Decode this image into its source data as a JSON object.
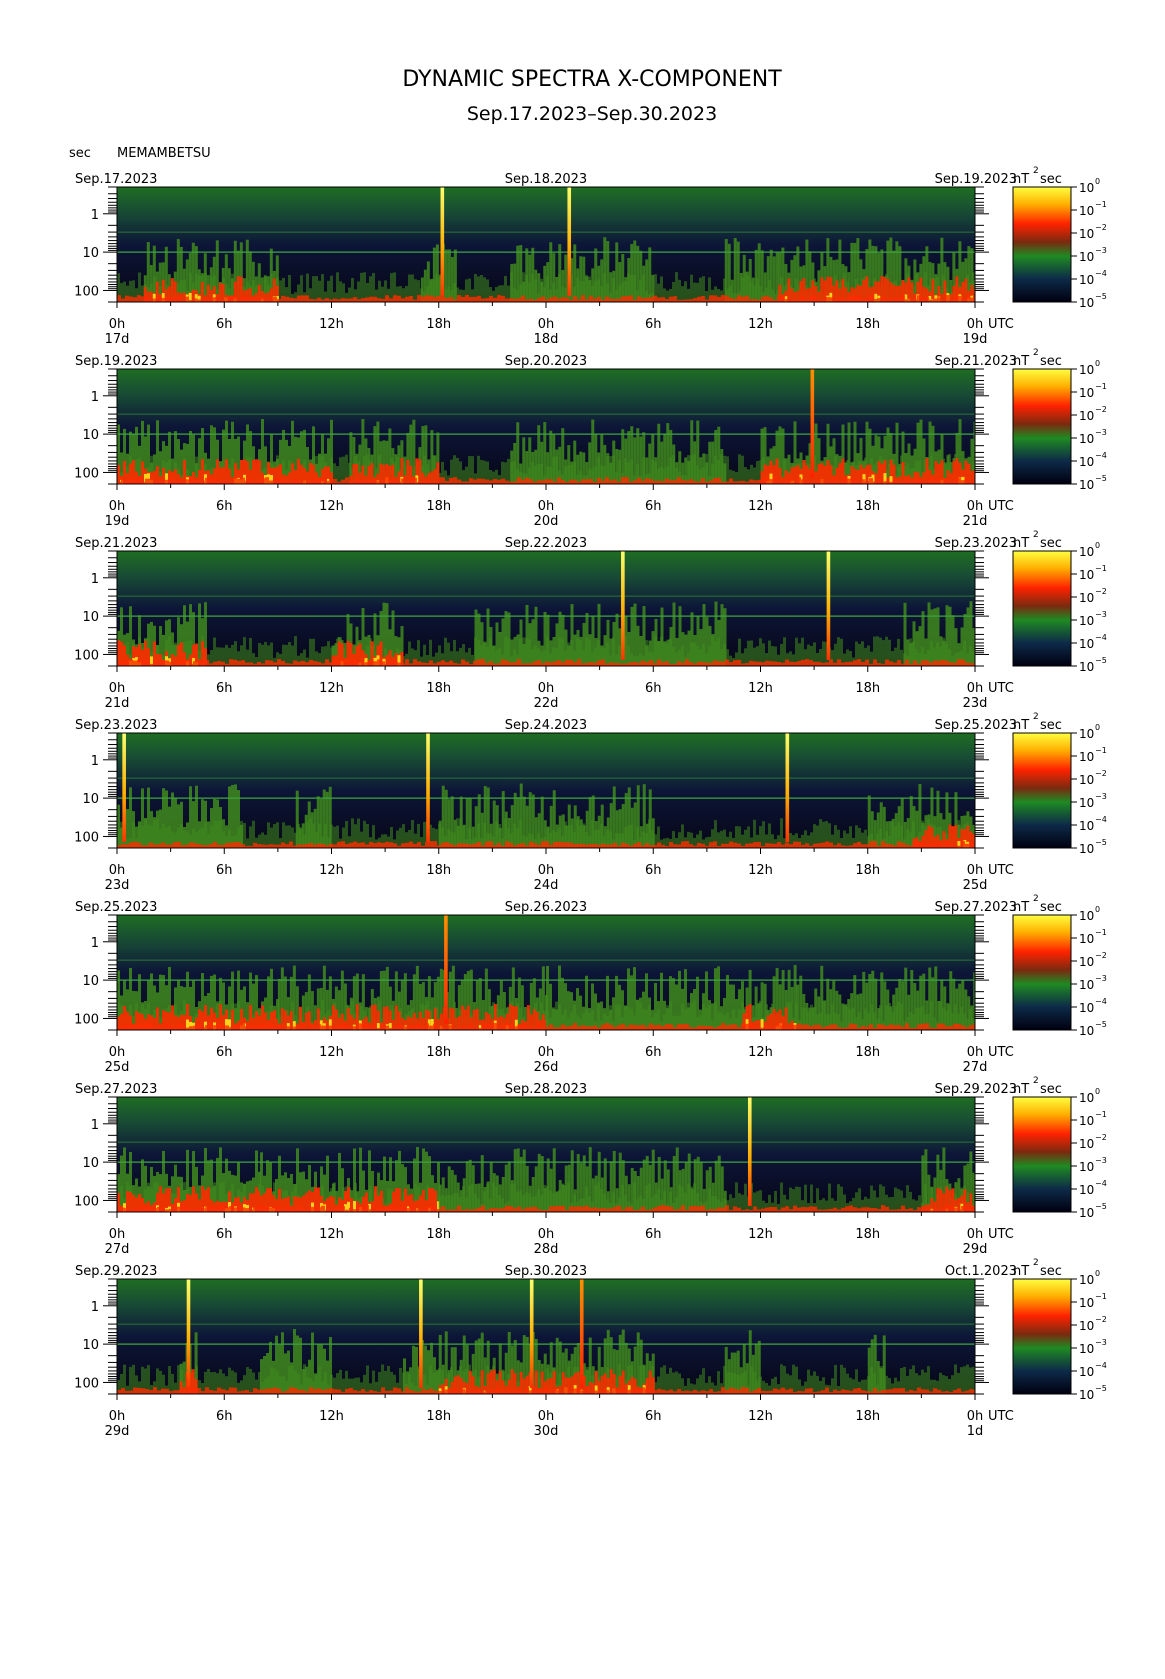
{
  "title": "DYNAMIC SPECTRA X-COMPONENT",
  "subtitle": "Sep.17.2023–Sep.30.2023",
  "station_units_label": "sec",
  "station": "MEMAMBETSU",
  "y_ticks": [
    "1",
    "10",
    "100"
  ],
  "time_axis_label": "UTC",
  "colorbar_unit": "nT²sec",
  "colorbar_unit_nT": "nT",
  "colorbar_unit_exp": "2",
  "colorbar_unit_sec": "sec",
  "colorbar_ticks": [
    {
      "base": "10",
      "exp": "0"
    },
    {
      "base": "10",
      "exp": "−1"
    },
    {
      "base": "10",
      "exp": "−2"
    },
    {
      "base": "10",
      "exp": "−3"
    },
    {
      "base": "10",
      "exp": "−4"
    },
    {
      "base": "10",
      "exp": "−5"
    }
  ],
  "colors": {
    "background_high": "#1e6a1e",
    "background_low": "#0a0a26",
    "activity": "#3f8a1d",
    "hot": "#ff2a00",
    "peak": "#ffd21a"
  },
  "chart_data": [
    {
      "type": "heatmap",
      "start_label": "Sep.17.2023",
      "mid_label": "Sep.18.2023",
      "end_label": "Sep.19.2023",
      "hour_ticks": [
        "0h",
        "6h",
        "12h",
        "18h",
        "0h",
        "6h",
        "12h",
        "18h",
        "0h"
      ],
      "day_ticks": [
        "17d",
        "18d",
        "19d"
      ],
      "ylabel": "sec",
      "ylim": [
        0.2,
        200
      ],
      "y_scale": "log",
      "colorbar_range": [
        1e-05,
        1
      ],
      "spikes": [
        {
          "time_h": 18.2,
          "intensity": "peak"
        },
        {
          "time_h": 25.3,
          "intensity": "peak"
        }
      ],
      "activity_bursts": [
        {
          "start_h": 1.5,
          "end_h": 9,
          "level": "hot"
        },
        {
          "start_h": 17,
          "end_h": 19,
          "level": "active"
        },
        {
          "start_h": 22,
          "end_h": 30,
          "level": "active"
        },
        {
          "start_h": 34,
          "end_h": 37,
          "level": "active"
        },
        {
          "start_h": 37,
          "end_h": 48,
          "level": "hot"
        }
      ]
    },
    {
      "type": "heatmap",
      "start_label": "Sep.19.2023",
      "mid_label": "Sep.20.2023",
      "end_label": "Sep.21.2023",
      "hour_ticks": [
        "0h",
        "6h",
        "12h",
        "18h",
        "0h",
        "6h",
        "12h",
        "18h",
        "0h"
      ],
      "day_ticks": [
        "19d",
        "20d",
        "21d"
      ],
      "ylabel": "sec",
      "ylim": [
        0.2,
        200
      ],
      "y_scale": "log",
      "colorbar_range": [
        1e-05,
        1
      ],
      "spikes": [
        {
          "time_h": 38.9,
          "intensity": "hot"
        }
      ],
      "activity_bursts": [
        {
          "start_h": 0,
          "end_h": 12,
          "level": "hot"
        },
        {
          "start_h": 13,
          "end_h": 18,
          "level": "hot"
        },
        {
          "start_h": 22,
          "end_h": 34,
          "level": "active"
        },
        {
          "start_h": 36,
          "end_h": 48,
          "level": "hot"
        }
      ]
    },
    {
      "type": "heatmap",
      "start_label": "Sep.21.2023",
      "mid_label": "Sep.22.2023",
      "end_label": "Sep.23.2023",
      "hour_ticks": [
        "0h",
        "6h",
        "12h",
        "18h",
        "0h",
        "6h",
        "12h",
        "18h",
        "0h"
      ],
      "day_ticks": [
        "21d",
        "22d",
        "23d"
      ],
      "ylabel": "sec",
      "ylim": [
        0.2,
        200
      ],
      "y_scale": "log",
      "colorbar_range": [
        1e-05,
        1
      ],
      "spikes": [
        {
          "time_h": 28.3,
          "intensity": "peak"
        },
        {
          "time_h": 39.8,
          "intensity": "peak"
        }
      ],
      "activity_bursts": [
        {
          "start_h": 0,
          "end_h": 5,
          "level": "hot"
        },
        {
          "start_h": 12,
          "end_h": 16,
          "level": "hot"
        },
        {
          "start_h": 20,
          "end_h": 34,
          "level": "active"
        },
        {
          "start_h": 44,
          "end_h": 48,
          "level": "active"
        }
      ]
    },
    {
      "type": "heatmap",
      "start_label": "Sep.23.2023",
      "mid_label": "Sep.24.2023",
      "end_label": "Sep.25.2023",
      "hour_ticks": [
        "0h",
        "6h",
        "12h",
        "18h",
        "0h",
        "6h",
        "12h",
        "18h",
        "0h"
      ],
      "day_ticks": [
        "23d",
        "24d",
        "25d"
      ],
      "ylabel": "sec",
      "ylim": [
        0.2,
        200
      ],
      "y_scale": "log",
      "colorbar_range": [
        1e-05,
        1
      ],
      "spikes": [
        {
          "time_h": 0.4,
          "intensity": "peak"
        },
        {
          "time_h": 17.4,
          "intensity": "peak"
        },
        {
          "time_h": 37.5,
          "intensity": "peak"
        }
      ],
      "activity_bursts": [
        {
          "start_h": 0,
          "end_h": 7,
          "level": "active"
        },
        {
          "start_h": 10,
          "end_h": 12,
          "level": "active"
        },
        {
          "start_h": 18,
          "end_h": 30,
          "level": "active"
        },
        {
          "start_h": 42,
          "end_h": 44.5,
          "level": "active"
        },
        {
          "start_h": 44.5,
          "end_h": 48,
          "level": "hot"
        }
      ]
    },
    {
      "type": "heatmap",
      "start_label": "Sep.25.2023",
      "mid_label": "Sep.26.2023",
      "end_label": "Sep.27.2023",
      "hour_ticks": [
        "0h",
        "6h",
        "12h",
        "18h",
        "0h",
        "6h",
        "12h",
        "18h",
        "0h"
      ],
      "day_ticks": [
        "25d",
        "26d",
        "27d"
      ],
      "ylabel": "sec",
      "ylim": [
        0.2,
        200
      ],
      "y_scale": "log",
      "colorbar_range": [
        1e-05,
        1
      ],
      "spikes": [
        {
          "time_h": 18.4,
          "intensity": "hot"
        }
      ],
      "activity_bursts": [
        {
          "start_h": 0,
          "end_h": 9,
          "level": "hot"
        },
        {
          "start_h": 9,
          "end_h": 24,
          "level": "hot"
        },
        {
          "start_h": 24,
          "end_h": 35,
          "level": "active"
        },
        {
          "start_h": 35,
          "end_h": 38,
          "level": "hot"
        },
        {
          "start_h": 38,
          "end_h": 48,
          "level": "active"
        }
      ]
    },
    {
      "type": "heatmap",
      "start_label": "Sep.27.2023",
      "mid_label": "Sep.28.2023",
      "end_label": "Sep.29.2023",
      "hour_ticks": [
        "0h",
        "6h",
        "12h",
        "18h",
        "0h",
        "6h",
        "12h",
        "18h",
        "0h"
      ],
      "day_ticks": [
        "27d",
        "28d",
        "29d"
      ],
      "ylabel": "sec",
      "ylim": [
        0.2,
        200
      ],
      "y_scale": "log",
      "colorbar_range": [
        1e-05,
        1
      ],
      "spikes": [
        {
          "time_h": 35.4,
          "intensity": "peak"
        }
      ],
      "activity_bursts": [
        {
          "start_h": 0,
          "end_h": 8,
          "level": "hot"
        },
        {
          "start_h": 8,
          "end_h": 18,
          "level": "hot"
        },
        {
          "start_h": 18,
          "end_h": 34,
          "level": "active"
        },
        {
          "start_h": 45,
          "end_h": 48,
          "level": "hot"
        }
      ]
    },
    {
      "type": "heatmap",
      "start_label": "Sep.29.2023",
      "mid_label": "Sep.30.2023",
      "end_label": "Oct.1.2023",
      "hour_ticks": [
        "0h",
        "6h",
        "12h",
        "18h",
        "0h",
        "6h",
        "12h",
        "18h",
        "0h"
      ],
      "day_ticks": [
        "29d",
        "30d",
        "1d"
      ],
      "ylabel": "sec",
      "ylim": [
        0.2,
        200
      ],
      "y_scale": "log",
      "colorbar_range": [
        1e-05,
        1
      ],
      "spikes": [
        {
          "time_h": 4.0,
          "intensity": "peak"
        },
        {
          "time_h": 17.0,
          "intensity": "peak"
        },
        {
          "time_h": 23.2,
          "intensity": "peak"
        },
        {
          "time_h": 26.0,
          "intensity": "hot"
        }
      ],
      "activity_bursts": [
        {
          "start_h": 3.5,
          "end_h": 4.5,
          "level": "hot"
        },
        {
          "start_h": 8,
          "end_h": 12,
          "level": "active"
        },
        {
          "start_h": 16,
          "end_h": 18,
          "level": "active"
        },
        {
          "start_h": 18,
          "end_h": 30,
          "level": "hot"
        },
        {
          "start_h": 34,
          "end_h": 36,
          "level": "active"
        },
        {
          "start_h": 42,
          "end_h": 43,
          "level": "active"
        }
      ]
    }
  ]
}
